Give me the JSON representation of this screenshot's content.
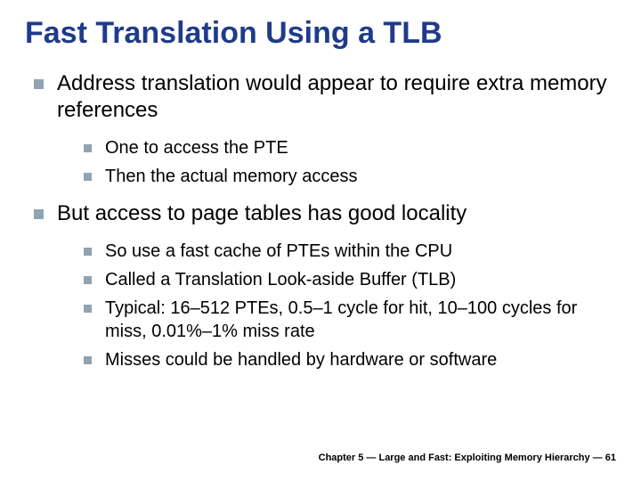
{
  "title": "Fast Translation Using a TLB",
  "bullets": [
    {
      "text": "Address translation would appear to require extra memory references",
      "sub": [
        {
          "text": "One to access the PTE"
        },
        {
          "text": "Then the actual memory access"
        }
      ]
    },
    {
      "text": "But access to page tables has good locality",
      "sub": [
        {
          "text": "So use a fast cache of PTEs within the CPU"
        },
        {
          "text": "Called a Translation Look-aside Buffer (TLB)"
        },
        {
          "text": "Typical: 16–512 PTEs, 0.5–1 cycle for hit, 10–100 cycles for miss, 0.01%–1% miss rate"
        },
        {
          "text": "Misses could be handled by hardware or software"
        }
      ]
    }
  ],
  "footer": "Chapter 5 — Large and Fast: Exploiting Memory Hierarchy — 61"
}
